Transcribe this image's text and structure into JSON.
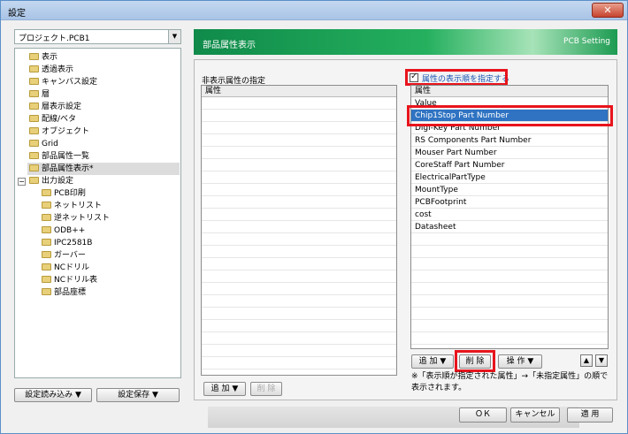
{
  "window": {
    "title": "設定",
    "close_label": "✕"
  },
  "project": {
    "value": "プロジェクト.PCB1",
    "dropdown_icon": "▼"
  },
  "tree": {
    "items": [
      {
        "label": "表示"
      },
      {
        "label": "透過表示"
      },
      {
        "label": "キャンバス設定"
      },
      {
        "label": "層"
      },
      {
        "label": "層表示設定"
      },
      {
        "label": "配線/ベタ"
      },
      {
        "label": "オブジェクト"
      },
      {
        "label": "Grid"
      },
      {
        "label": "部品属性一覧"
      },
      {
        "label": "部品属性表示*"
      },
      {
        "label": "出力設定"
      },
      {
        "label": "PCB印刷"
      },
      {
        "label": "ネットリスト"
      },
      {
        "label": "逆ネットリスト"
      },
      {
        "label": "ODB++"
      },
      {
        "label": "IPC2581B"
      },
      {
        "label": "ガーバー"
      },
      {
        "label": "NCドリル"
      },
      {
        "label": "NCドリル表"
      },
      {
        "label": "部品座標"
      }
    ],
    "expander_symbol": "−"
  },
  "bottom_left": {
    "load_label": "設定読み込み ▼",
    "save_label": "設定保存 ▼"
  },
  "header": {
    "title": "部品属性表示",
    "right": "PCB Setting"
  },
  "hidden_panel": {
    "label": "非表示属性の指定",
    "column": "属性",
    "add_label": "追 加 ▼",
    "delete_label": "削 除"
  },
  "display_panel": {
    "checkbox_label": "属性の表示順を指定する",
    "column": "属性",
    "rows": [
      "Value",
      "Chip1Stop Part Number",
      "Digi-Key Part Number",
      "RS Components Part Number",
      "Mouser Part Number",
      "CoreStaff Part Number",
      "ElectricalPartType",
      "MountType",
      "PCBFootprint",
      "cost",
      "Datasheet"
    ],
    "selected_row": "Chip1Stop Part Number",
    "add_label": "追 加 ▼",
    "delete_label": "削 除",
    "operation_label": "操 作 ▼",
    "up_icon": "▲",
    "down_icon": "▼",
    "note": "※「表示順が指定された属性」→「未指定属性」の順で表示されます。"
  },
  "footer": {
    "ok": "ＯＫ",
    "cancel": "キャンセル",
    "apply": "適 用"
  },
  "colors": {
    "accent": "#2f73c2",
    "highlight": "#e8141c",
    "header_green": "#25b05e"
  }
}
